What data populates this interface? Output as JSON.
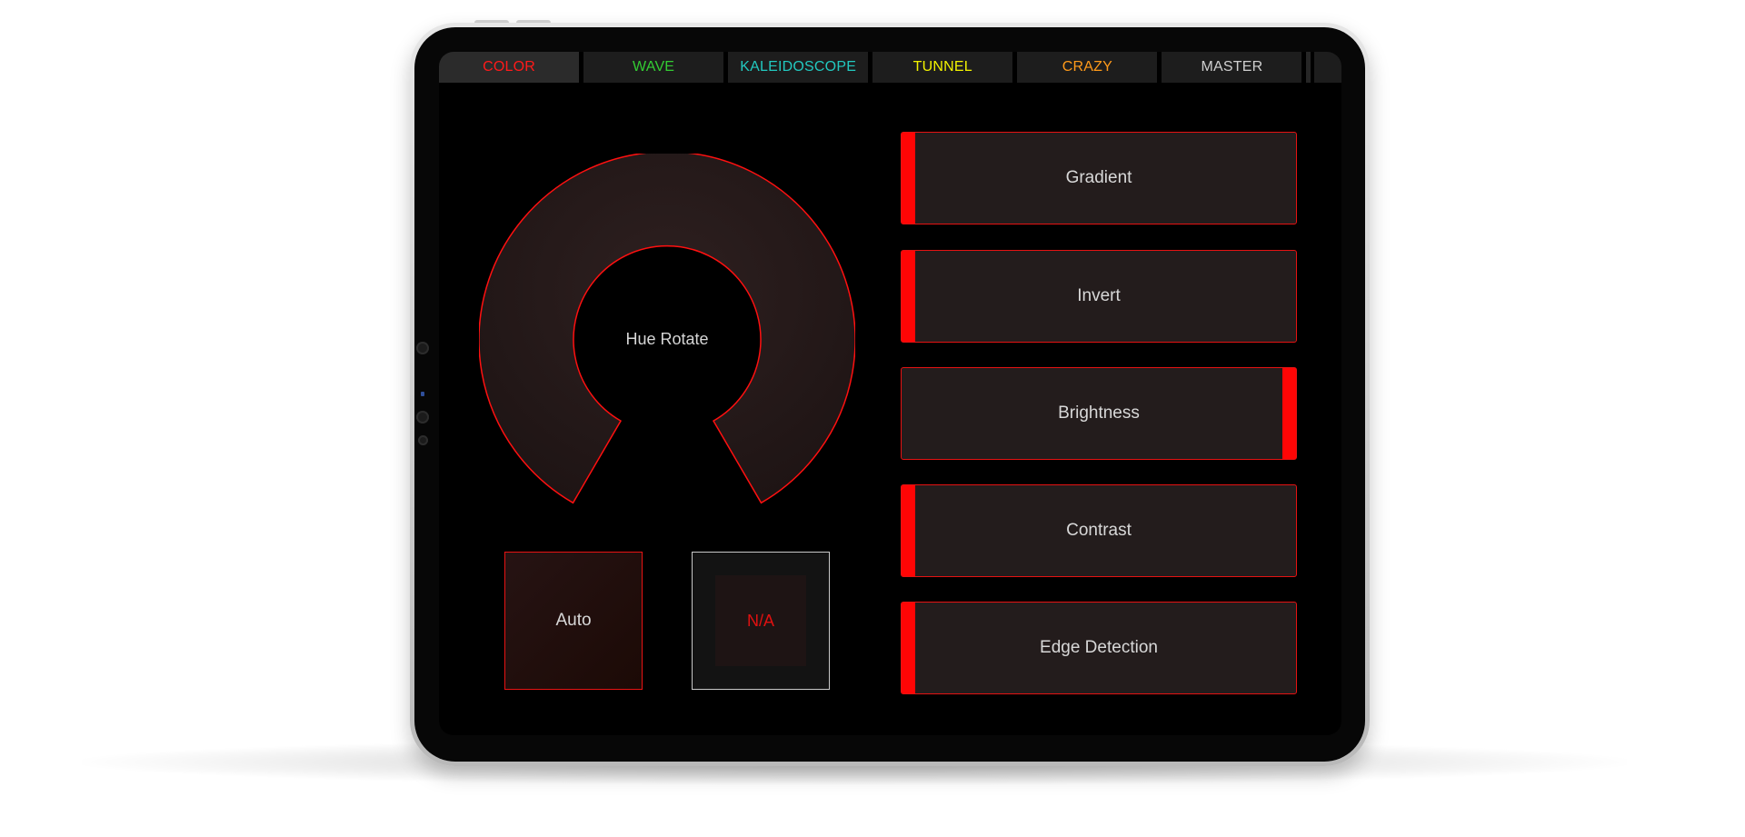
{
  "tabs": [
    {
      "label": "COLOR",
      "color": "#ff1a1a",
      "active": true
    },
    {
      "label": "WAVE",
      "color": "#33cc33",
      "active": false
    },
    {
      "label": "KALEIDOSCOPE",
      "color": "#22c9c0",
      "active": false
    },
    {
      "label": "TUNNEL",
      "color": "#f2f200",
      "active": false
    },
    {
      "label": "CRAZY",
      "color": "#ff9a1a",
      "active": false
    },
    {
      "label": "MASTER",
      "color": "#cfcfcf",
      "active": false
    }
  ],
  "knob": {
    "label": "Hue Rotate",
    "accent": "#ff1010"
  },
  "pads": {
    "auto_label": "Auto",
    "na_label": "N/A"
  },
  "toggles": [
    {
      "label": "Gradient",
      "indicator": "left"
    },
    {
      "label": "Invert",
      "indicator": "left"
    },
    {
      "label": "Brightness",
      "indicator": "right"
    },
    {
      "label": "Contrast",
      "indicator": "left"
    },
    {
      "label": "Edge Detection",
      "indicator": "left"
    }
  ],
  "colors": {
    "accent": "#ff0505",
    "panel": "#231c1c",
    "screen": "#000000"
  }
}
